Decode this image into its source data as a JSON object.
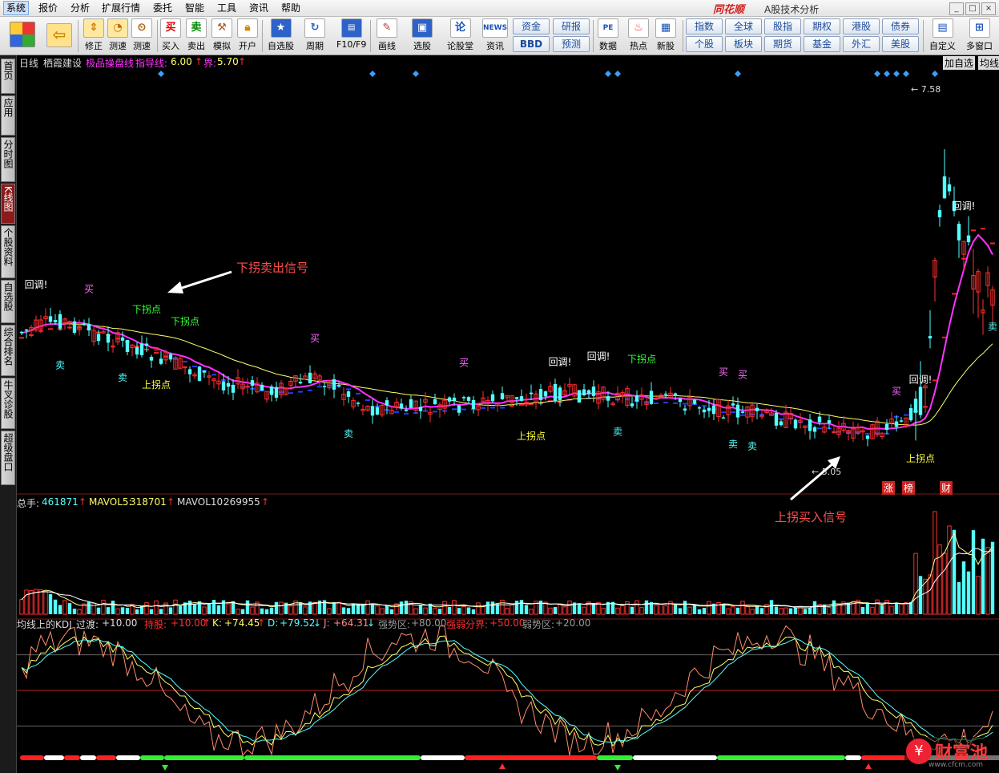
{
  "menu": {
    "items": [
      "系统",
      "报价",
      "分析",
      "扩展行情",
      "委托",
      "智能",
      "工具",
      "资讯",
      "帮助"
    ],
    "brand": "同花顺",
    "subtitle": "A股技术分析"
  },
  "toolbar": {
    "buttons": [
      {
        "label": "",
        "icon": "home-grid-icon"
      },
      {
        "label": "",
        "icon": "back-arrow-icon"
      },
      {
        "label": "修正",
        "icon": "up-down-arrows-icon"
      },
      {
        "label": "测速",
        "icon": "clock-icon"
      },
      {
        "label": "买入",
        "icon": "buy-icon",
        "glyph": "买"
      },
      {
        "label": "卖出",
        "icon": "sell-icon",
        "glyph": "卖"
      },
      {
        "label": "模拟",
        "icon": "gavel-icon"
      },
      {
        "label": "开户",
        "icon": "lock-icon"
      },
      {
        "label": "自选股",
        "icon": "star-icon"
      },
      {
        "label": "周期",
        "icon": "cycle-icon"
      },
      {
        "label": "F10/F9",
        "icon": "f10-icon"
      },
      {
        "label": "画线",
        "icon": "pencil-icon"
      },
      {
        "label": "选股",
        "icon": "monitor-icon"
      },
      {
        "label": "论股堂",
        "icon": "lun-icon",
        "glyph": "论"
      },
      {
        "label": "资讯",
        "icon": "news-icon",
        "glyph": "NEWS"
      },
      {
        "label": "数据",
        "icon": "pe-icon",
        "glyph": "PE"
      },
      {
        "label": "热点",
        "icon": "hot-icon"
      },
      {
        "label": "新股",
        "icon": "new-stock-icon"
      },
      {
        "label": "自定义",
        "icon": "custom-icon"
      },
      {
        "label": "多窗口",
        "icon": "multi-window-icon"
      }
    ],
    "grid_buttons": [
      [
        "资金",
        "研报"
      ],
      [
        "BBD",
        "预测"
      ],
      [
        "指数",
        "全球",
        "股指",
        "期权",
        "港股",
        "债券"
      ],
      [
        "个股",
        "板块",
        "期货",
        "基金",
        "外汇",
        "美股"
      ]
    ]
  },
  "left_tabs": [
    "首页",
    "应用",
    "分时图",
    "K线图",
    "个股资料",
    "自选股",
    "综合排名",
    "牛叉诊股",
    "超级盘口"
  ],
  "chart_header": {
    "period": "日线",
    "stock": "栖霞建设",
    "indicator": "极品操盘线",
    "guide_label": "指导线:",
    "guide_value": "6.00",
    "bound_label": "界:",
    "bound_value": "5.70",
    "right_tabs": [
      "加自选",
      "均线"
    ]
  },
  "annotations": {
    "sell_signal": "下拐卖出信号",
    "buy_signal": "上拐买入信号",
    "high_mark": "7.58",
    "low_mark": "5.05",
    "badges": [
      "涨",
      "榜",
      "财"
    ]
  },
  "price_signals": [
    {
      "text": "回调!",
      "i": 3,
      "where": "top",
      "type": "callout"
    },
    {
      "text": "买",
      "i": 14,
      "where": "top",
      "type": "buy"
    },
    {
      "text": "下拐点",
      "i": 26,
      "where": "top",
      "type": "down"
    },
    {
      "text": "下拐点",
      "i": 34,
      "where": "top",
      "type": "down"
    },
    {
      "text": "卖",
      "i": 8,
      "where": "bot",
      "type": "sell"
    },
    {
      "text": "卖",
      "i": 21,
      "where": "bot",
      "type": "sell"
    },
    {
      "text": "上拐点",
      "i": 28,
      "where": "bot",
      "type": "up"
    },
    {
      "text": "买",
      "i": 61,
      "where": "top",
      "type": "buy"
    },
    {
      "text": "卖",
      "i": 68,
      "where": "bot",
      "type": "sell"
    },
    {
      "text": "买",
      "i": 92,
      "where": "top",
      "type": "buy"
    },
    {
      "text": "回调!",
      "i": 112,
      "where": "top",
      "type": "callout"
    },
    {
      "text": "回调!",
      "i": 120,
      "where": "top",
      "type": "callout"
    },
    {
      "text": "上拐点",
      "i": 106,
      "where": "bot",
      "type": "up"
    },
    {
      "text": "下拐点",
      "i": 129,
      "where": "top",
      "type": "down"
    },
    {
      "text": "卖",
      "i": 124,
      "where": "bot",
      "type": "sell"
    },
    {
      "text": "买",
      "i": 146,
      "where": "top",
      "type": "buy"
    },
    {
      "text": "买",
      "i": 150,
      "where": "top",
      "type": "buy"
    },
    {
      "text": "卖",
      "i": 148,
      "where": "bot",
      "type": "sell"
    },
    {
      "text": "卖",
      "i": 152,
      "where": "bot",
      "type": "sell"
    },
    {
      "text": "买",
      "i": 182,
      "where": "top",
      "type": "buy"
    },
    {
      "text": "回调!",
      "i": 187,
      "where": "top",
      "type": "callout"
    },
    {
      "text": "上拐点",
      "i": 187,
      "where": "bot",
      "type": "up"
    },
    {
      "text": "回调!",
      "i": 196,
      "where": "top",
      "type": "callout"
    },
    {
      "text": "卖",
      "i": 202,
      "where": "bot",
      "type": "sell"
    }
  ],
  "volume_header": {
    "label": "总手:",
    "value": "461871",
    "ma5_label": "MAVOL5:",
    "ma5_value": "318701",
    "ma10_label": "MAVOL10:",
    "ma10_value": "269955"
  },
  "kdj_header": {
    "title": "均线上的KDJ",
    "transition_label": "过渡:",
    "transition_value": "+10.00",
    "hold_label": "持股:",
    "hold_value": "+10.00",
    "k_label": "K:",
    "k_value": "+74.45",
    "d_label": "D:",
    "d_value": "+79.52",
    "j_label": "J:",
    "j_value": "+64.31",
    "strong_label": "强势区:",
    "strong_value": "+80.00",
    "divide_label": "强弱分界:",
    "divide_value": "+50.00",
    "weak_label": "弱势区:",
    "weak_value": "+20.00"
  },
  "watermark": {
    "text": "财富池",
    "url": "www.cfcm.com"
  },
  "colors": {
    "up": "#ff3030",
    "down": "#54ffff",
    "ma_magenta": "#ff33ff",
    "ma_yellow": "#ffff66",
    "guide_blue": "#1f3fff"
  },
  "chart_data": {
    "type": "candlestick",
    "stock": "栖霞建设",
    "price_levels": {
      "guide_line": 6.0,
      "bound": 5.7,
      "high": 7.58,
      "low": 5.05
    },
    "volume": {
      "total": 461871,
      "mavol5": 318701,
      "mavol10": 269955
    },
    "kdj": {
      "K": 74.45,
      "D": 79.52,
      "J": 64.31,
      "strong_zone": 80,
      "divide": 50,
      "weak_zone": 20,
      "transition": 10,
      "hold": 10
    }
  }
}
